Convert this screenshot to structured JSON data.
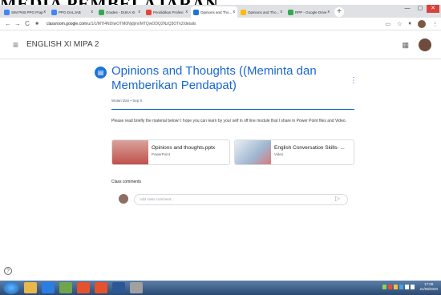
{
  "overlay": {
    "text": "MEDIA PEMBELAJARAN"
  },
  "tabs": [
    {
      "label": "SIM PKB PPG Prajab",
      "color": "#4285f4"
    },
    {
      "label": "PPG DALJAB",
      "color": "#4285f4"
    },
    {
      "label": "Grades - DUKA XI",
      "color": "#34a853"
    },
    {
      "label": "Pendidikan Profesi",
      "color": "#ea4335"
    },
    {
      "label": "Opinions and Tho...",
      "color": "#1e73d8",
      "active": true
    },
    {
      "label": "Opinions and Tho...",
      "color": "#fbbc04"
    },
    {
      "label": "RPP - Google Drive",
      "color": "#34a853"
    }
  ],
  "newtab": "+",
  "window": {
    "min": "—",
    "max": "▢",
    "close": "✕"
  },
  "address": {
    "host": "classroom.google.com",
    "path": "/u/1/c/MTI4NDIwOTM0Njdj/m/MTQwODQ2NzQ3OTk2/details"
  },
  "app": {
    "class_name": "ENGLISH XI MIPA 2"
  },
  "post": {
    "title": "Opinions and Thoughts ((Meminta dan Memberikan Pendapat)",
    "meta": "Wulan Dari • Sep 8",
    "description": "Please read briefly the material below! I hope you can learn by your self in off line module that I share in Power Point files and Video."
  },
  "attachments": [
    {
      "title": "Opinions and thoughts.pptx",
      "type": "PowerPoint",
      "thumb_color": "#c0504d"
    },
    {
      "title": "English Conversation Skills- ...",
      "type": "Video",
      "thumb_color": "#9fb6d0"
    }
  ],
  "comments": {
    "label": "Class comments",
    "placeholder": "Add class comment..."
  },
  "taskbar": {
    "time": "17:09",
    "date": "21/09/2020"
  }
}
